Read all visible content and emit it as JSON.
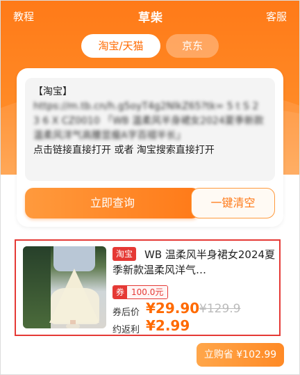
{
  "header": {
    "left": "教程",
    "title": "草柴",
    "right": "客服"
  },
  "tabs": [
    {
      "label": "淘宝/天猫"
    },
    {
      "label": "京东"
    }
  ],
  "paste": {
    "line1": "【淘宝】",
    "blurred": "https://m.tb.cn/h.g5oyT4g2NlkZ65?tk=\n5 t S 2 3 6 X   CZ0010 「WB 温柔风半身裙女2024夏季新款温柔风洋气高腰显瘦A字百褶半长」",
    "line_end": "点击链接直接打开 或者 淘宝搜索直接打开"
  },
  "buttons": {
    "query": "立即查询",
    "clear": "一键清空",
    "buy": "立购省 ¥102.99"
  },
  "product": {
    "platform_tag": "淘宝",
    "title": "WB 温柔风半身裙女2024夏季新款温柔风洋气…",
    "coupon_label": "券",
    "coupon_value": "100.0元",
    "after_price_label": "券后价",
    "after_price": "¥29.90",
    "original_price": "¥129.9",
    "rebate_label": "约返利",
    "rebate": "¥2.99"
  },
  "colors": {
    "accent": "#ff7a18",
    "highlight_border": "#e53935"
  }
}
